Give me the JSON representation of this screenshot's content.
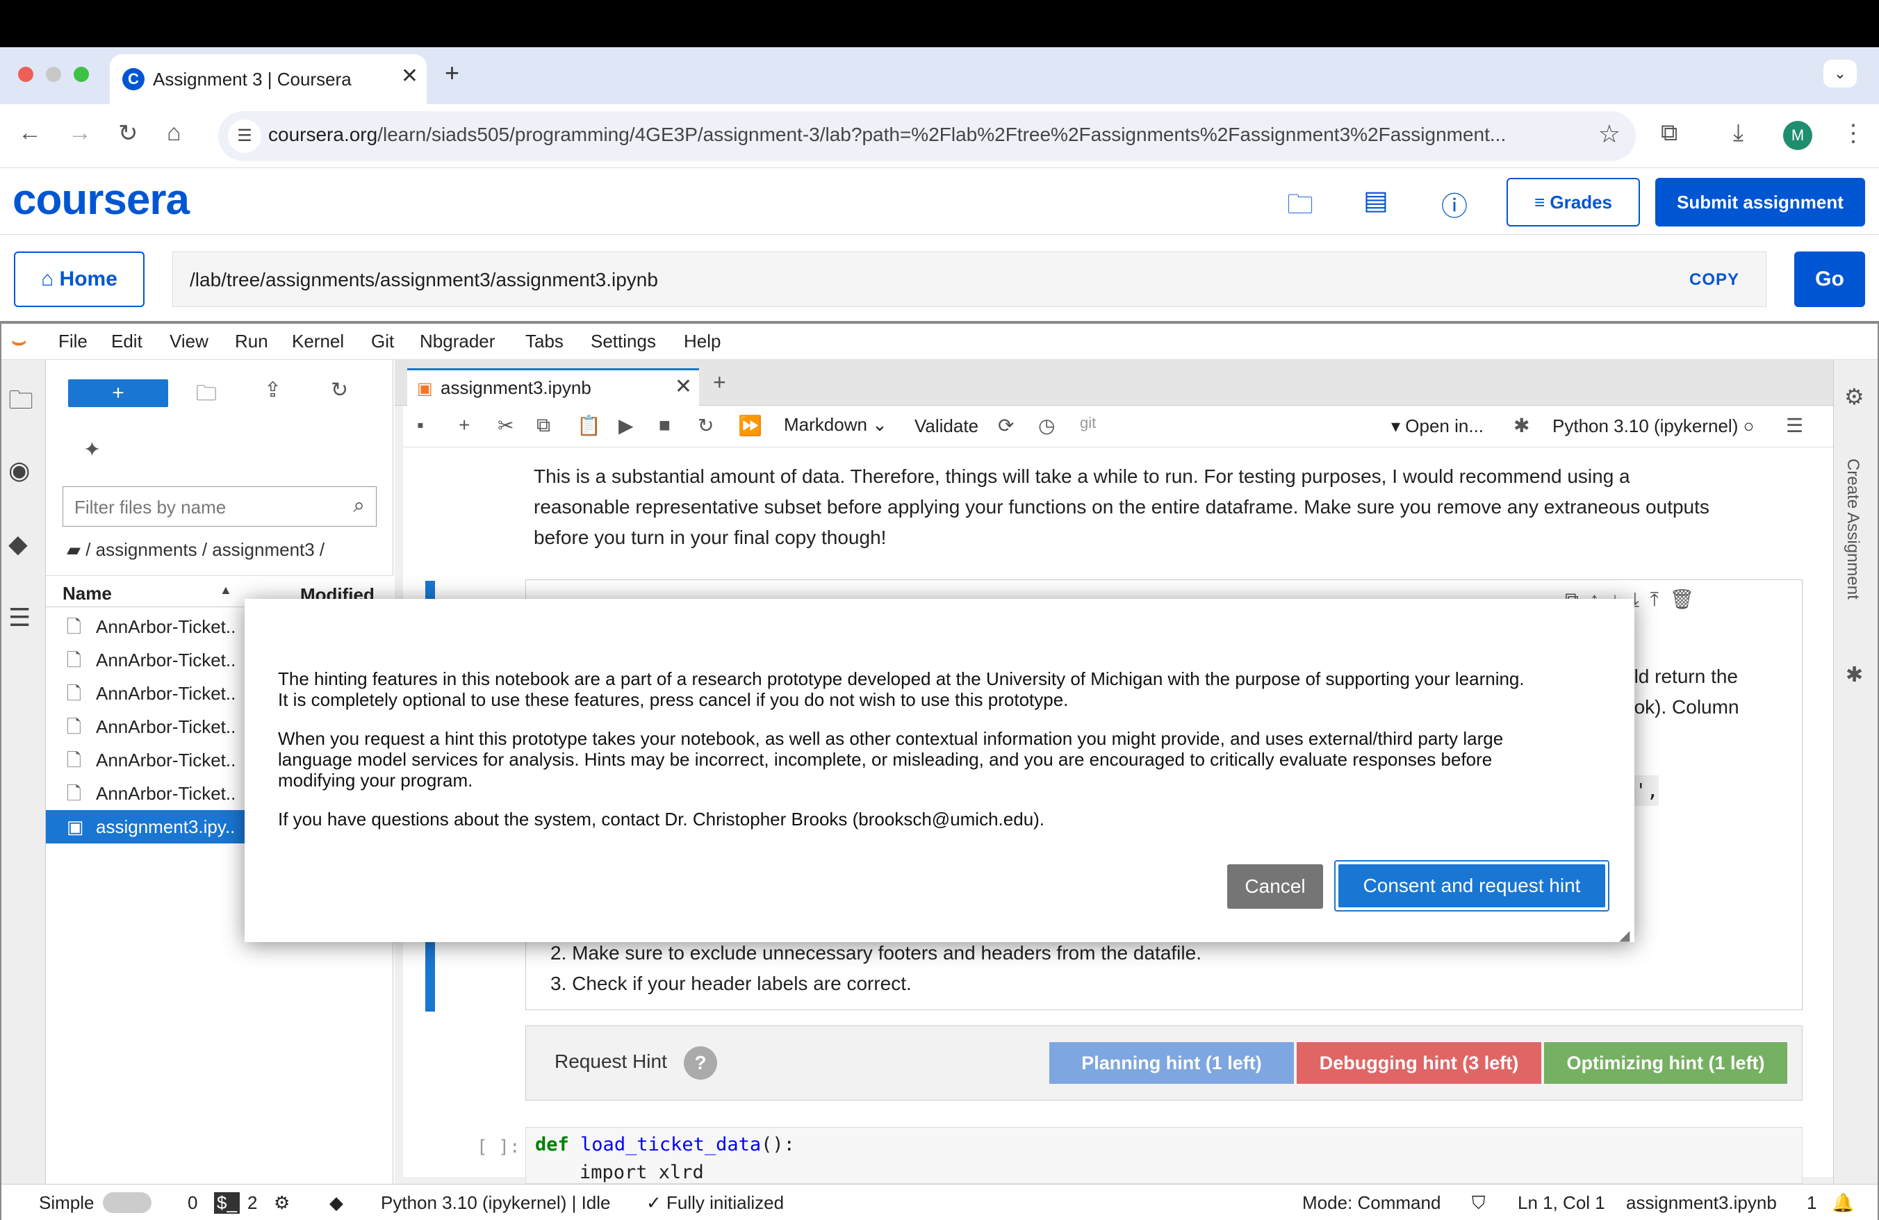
{
  "browser": {
    "tab_title": "Assignment 3 | Coursera",
    "tab_favicon": "C",
    "url_host": "coursera.org",
    "url_path": "/learn/siads505/programming/4GE3P/assignment-3/lab?path=%2Flab%2Ftree%2Fassignments%2Fassignment3%2Fassignment...",
    "avatar_initial": "M"
  },
  "coursera": {
    "logo": "coursera",
    "grades_label": "Grades",
    "submit_label": "Submit assignment",
    "home_label": "Home",
    "path_value": "/lab/tree/assignments/assignment3/assignment3.ipynb",
    "copy_label": "COPY",
    "go_label": "Go"
  },
  "menubar": [
    "File",
    "Edit",
    "View",
    "Run",
    "Kernel",
    "Git",
    "Nbgrader",
    "Tabs",
    "Settings",
    "Help"
  ],
  "filebrowser": {
    "filter_placeholder": "Filter files by name",
    "breadcrumb": "/ assignments / assignment3 /",
    "col_name": "Name",
    "col_modified": "Modified",
    "files": [
      "AnnArbor-Ticket..",
      "AnnArbor-Ticket..",
      "AnnArbor-Ticket..",
      "AnnArbor-Ticket..",
      "AnnArbor-Ticket..",
      "AnnArbor-Ticket..",
      "assignment3.ipy.."
    ]
  },
  "notebook": {
    "tab_label": "assignment3.ipynb",
    "cell_type": "Markdown",
    "validate_label": "Validate",
    "git_label": "git",
    "open_in_label": "Open in...",
    "kernel_label": "Python 3.10 (ipykernel)",
    "intro_lines": [
      "This is a substantial amount of data. Therefore, things will take a while to run. For testing purposes, I would recommend using a",
      "reasonable representative subset before applying your functions on the entire dataframe. Make sure you remove any extraneous outputs",
      "before you turn in your final copy though!"
    ],
    "partial_right_1": "uld return the",
    "partial_right_2": "ook). Column",
    "partial_right_3": "n',",
    "list_item_2": "2. Make sure to exclude unnecessary footers and headers from the datafile.",
    "list_item_3": "3. Check if your header labels are correct.",
    "request_hint_label": "Request Hint",
    "hint_q": "?",
    "planning_hint": "Planning hint (1 left)",
    "debugging_hint": "Debugging hint (3 left)",
    "optimizing_hint": "Optimizing hint (1 left)",
    "code_prompt": "[ ]:",
    "code_line_1_kw": "def",
    "code_line_1_fn": "load_ticket_data",
    "code_line_1_rest": "():",
    "code_line_2": "import xlrd",
    "create_assignment_label": "Create Assignment"
  },
  "statusbar": {
    "mode_simple": "Simple",
    "count_a": "0",
    "count_b": "2",
    "kernel_status": "Python 3.10 (ipykernel) | Idle",
    "init_status": "Fully initialized",
    "mode": "Mode: Command",
    "position": "Ln 1, Col 1",
    "filename": "assignment3.ipynb",
    "notifications": "1"
  },
  "modal": {
    "para1_line1": "The hinting features in this notebook are a part of a research prototype developed at the University of Michigan with the purpose of supporting your learning.",
    "para1_line2": "It is completely optional to use these features, press cancel if you do not wish to use this prototype.",
    "para2_line1": "When you request a hint this prototype takes your notebook, as well as other contextual information you might provide, and uses external/third party large",
    "para2_line2": "language model services for analysis. Hints may be incorrect, incomplete, or misleading, and you are encouraged to critically evaluate responses before",
    "para2_line3": "modifying your program.",
    "para3": "If you have questions about the system, contact Dr. Christopher Brooks (brooksch@umich.edu).",
    "cancel_label": "Cancel",
    "consent_label": "Consent and request hint"
  },
  "colors": {
    "coursera_blue": "#0056d2",
    "jupyter_blue": "#1976d2",
    "planning": "#7ea6e0",
    "debugging": "#e06666",
    "optimizing": "#76b062"
  }
}
